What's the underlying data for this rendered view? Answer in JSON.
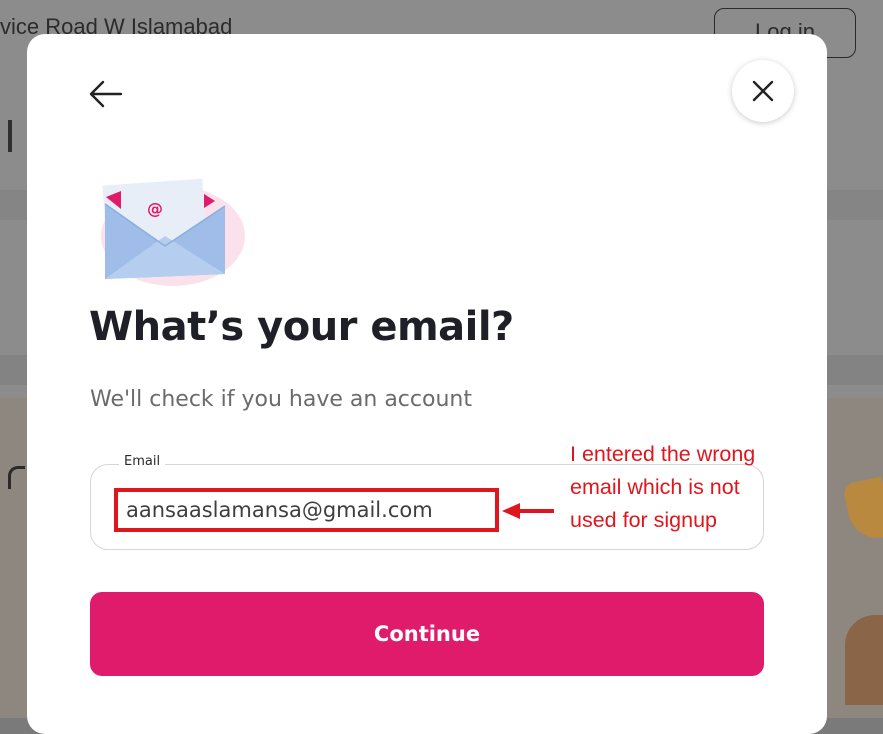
{
  "background": {
    "address_text": "vice Road W Islamabad",
    "login_label": "Log in"
  },
  "modal": {
    "back_icon": "arrow-left-icon",
    "close_icon": "close-icon",
    "illustration_icon": "envelope-at-icon",
    "title": "What’s your email?",
    "subtitle": "We'll check if you have an account",
    "email": {
      "label": "Email",
      "value": "aansaaslamansa@gmail.com"
    },
    "continue_label": "Continue"
  },
  "annotation": {
    "lines": [
      "I entered the wrong",
      "email which is not",
      "used for signup"
    ],
    "color": "#e0161e"
  },
  "colors": {
    "accent": "#e01b6b",
    "annotation": "#e0161e",
    "title": "#1f1f27",
    "subtitle": "#6b6b6b"
  }
}
